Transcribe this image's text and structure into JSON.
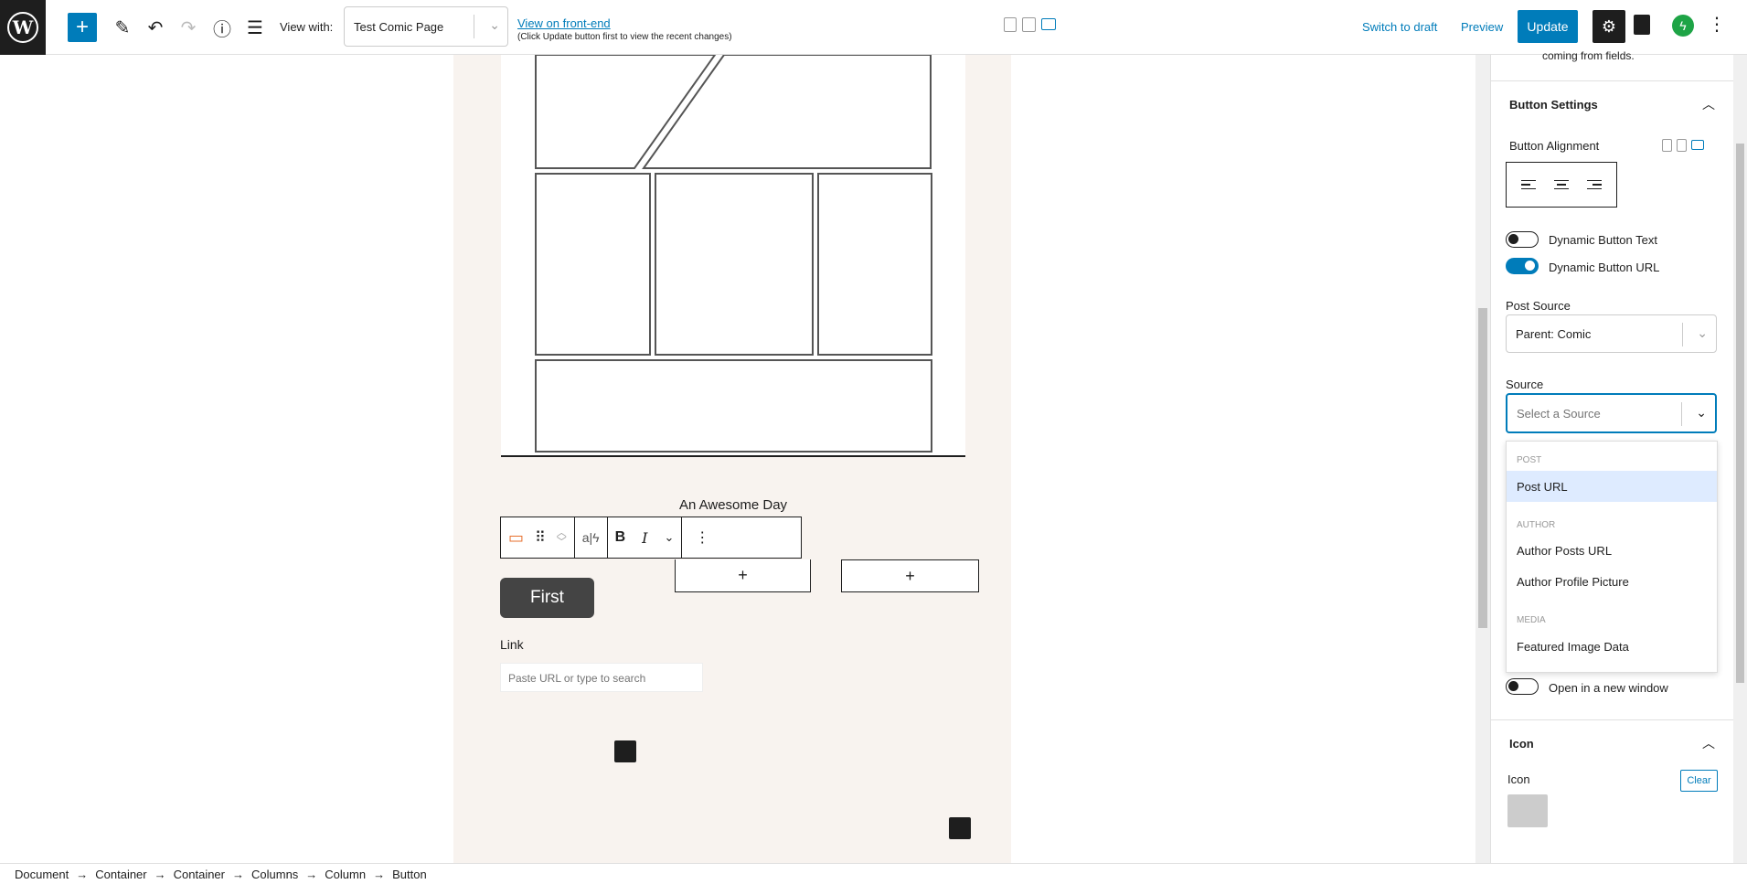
{
  "toolbar": {
    "view_with_label": "View with:",
    "view_select_value": "Test Comic Page",
    "front_end_link": "View on front-end",
    "front_end_note": "(Click Update button first to view the recent changes)",
    "switch_draft": "Switch to draft",
    "preview": "Preview",
    "update": "Update"
  },
  "canvas": {
    "image_caption": "An Awesome Day",
    "first_button": "First",
    "link_label": "Link",
    "link_placeholder": "Paste URL or type to search"
  },
  "breadcrumb": [
    "Document",
    "Container",
    "Container",
    "Columns",
    "Column",
    "Button"
  ],
  "sidebar": {
    "top_text": "coming from fields.",
    "button_settings_title": "Button Settings",
    "button_alignment_label": "Button Alignment",
    "dynamic_text_label": "Dynamic Button Text",
    "dynamic_url_label": "Dynamic Button URL",
    "dynamic_text_on": false,
    "dynamic_url_on": true,
    "post_source_label": "Post Source",
    "post_source_value": "Parent: Comic",
    "source_label": "Source",
    "source_placeholder": "Select a Source",
    "dropdown": {
      "groups": [
        {
          "label": "POST",
          "items": [
            "Post URL"
          ]
        },
        {
          "label": "AUTHOR",
          "items": [
            "Author Posts URL",
            "Author Profile Picture"
          ]
        },
        {
          "label": "MEDIA",
          "items": [
            "Featured Image Data"
          ]
        }
      ]
    },
    "new_window_label": "Open in a new window",
    "icon_section_title": "Icon",
    "icon_label": "Icon",
    "clear_label": "Clear"
  },
  "colors": {
    "accent": "#007cba",
    "page_bg": "#f8f3ef",
    "button_dark": "#444444"
  }
}
